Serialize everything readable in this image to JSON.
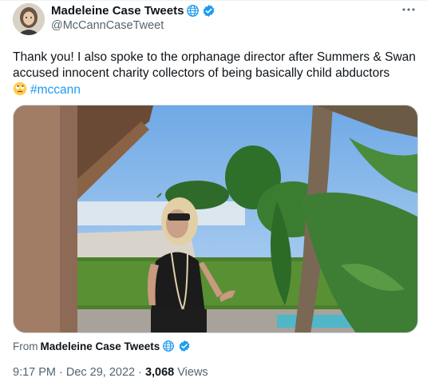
{
  "author": {
    "display_name": "Madeleine Case Tweets",
    "handle": "@McCannCaseTweet",
    "avatar_icon": "profile-photo",
    "badges": [
      "globe-icon",
      "verified-icon"
    ]
  },
  "tweet": {
    "text": "Thank you! I also spoke to the orphanage director after Summers & Swan accused innocent charity collectors of being basically child abductors",
    "emoji": "face-with-rolling-eyes-icon",
    "hashtag": "#mccann",
    "link_color": "#1d9bf0"
  },
  "media": {
    "type": "video-still",
    "description_icon": "woman-on-patio-video"
  },
  "source": {
    "from_label": "From",
    "from_name": "Madeleine Case Tweets"
  },
  "meta": {
    "time": "9:17 PM",
    "separator": "·",
    "date": "Dec 29, 2022",
    "views_count": "3,068",
    "views_label": "Views"
  },
  "colors": {
    "text": "#0f1419",
    "secondary": "#536471",
    "verified": "#1d9bf0"
  }
}
